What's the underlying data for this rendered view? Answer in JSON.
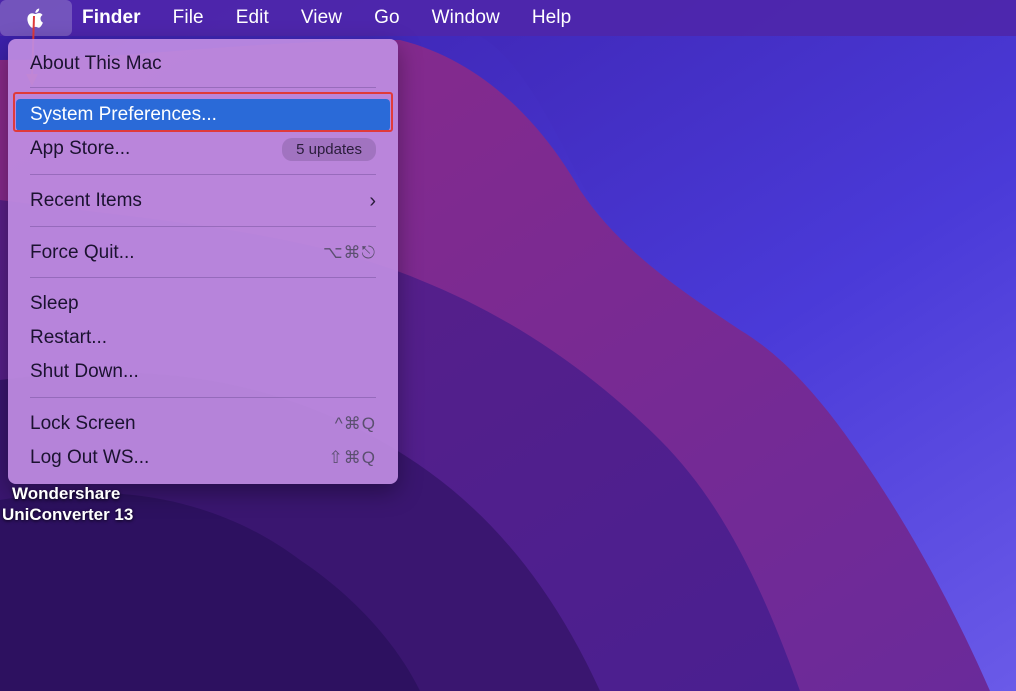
{
  "menubar": {
    "app_name": "Finder",
    "items": [
      "File",
      "Edit",
      "View",
      "Go",
      "Window",
      "Help"
    ]
  },
  "apple_menu": {
    "about": "About This Mac",
    "system_preferences": "System Preferences...",
    "app_store": "App Store...",
    "app_store_badge": "5 updates",
    "recent_items": "Recent Items",
    "force_quit": "Force Quit...",
    "force_quit_shortcut": "⌥⌘⎋",
    "sleep": "Sleep",
    "restart": "Restart...",
    "shut_down": "Shut Down...",
    "lock_screen": "Lock Screen",
    "lock_screen_shortcut": "^⌘Q",
    "log_out": "Log Out WS...",
    "log_out_shortcut": "⇧⌘Q"
  },
  "desktop_icon": {
    "line1": "Wondershare",
    "line2": "UniConverter 13"
  },
  "icons": {
    "apple": "apple-logo-icon",
    "chevron": "chevron-right-icon"
  },
  "colors": {
    "highlight": "#2a6ad8",
    "annotation": "#e03a3a"
  }
}
